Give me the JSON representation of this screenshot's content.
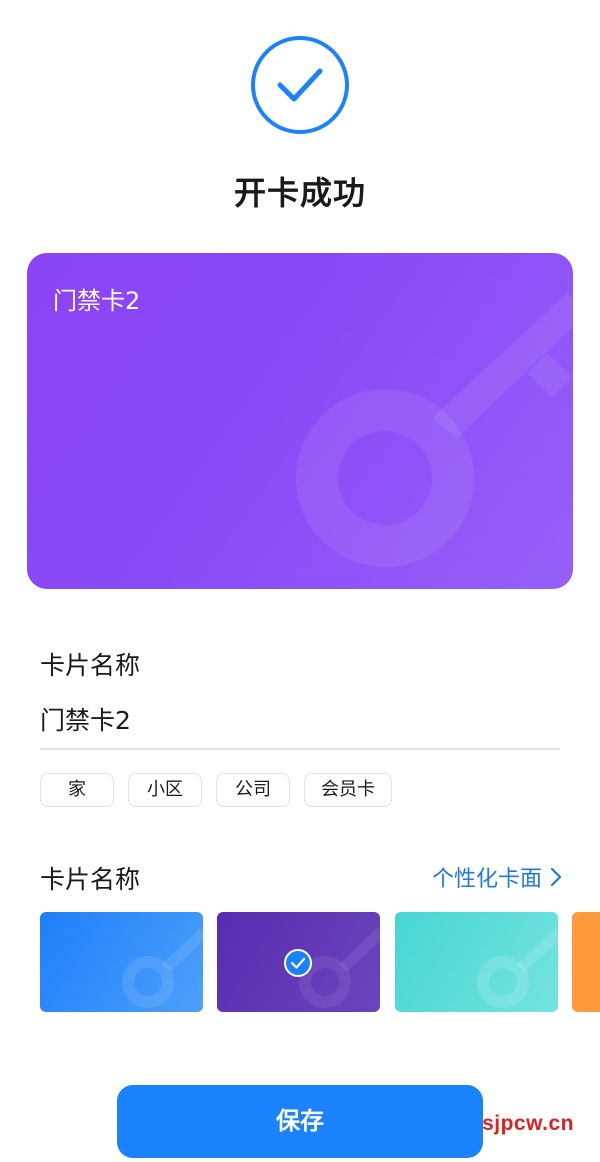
{
  "header": {
    "title": "开卡成功",
    "status_icon": "check-circle-icon",
    "accent_color": "#1a82fb"
  },
  "card": {
    "name": "门禁卡2",
    "color": "#8b45f6"
  },
  "name_section": {
    "label": "卡片名称",
    "value": "门禁卡2"
  },
  "tags": [
    {
      "label": "家"
    },
    {
      "label": "小区"
    },
    {
      "label": "公司"
    },
    {
      "label": "会员卡"
    }
  ],
  "skin_section": {
    "label": "卡片名称",
    "customize_label": "个性化卡面",
    "customize_icon": "chevron-right-icon",
    "link_color": "#1f7ae0",
    "skins": [
      {
        "name": "blue",
        "color": "#2a86fb",
        "selected": false
      },
      {
        "name": "purple",
        "color": "#5a2fb2",
        "selected": true
      },
      {
        "name": "cyan",
        "color": "#52d9d6",
        "selected": false
      },
      {
        "name": "orange",
        "color": "#ff9a3c",
        "selected": false
      }
    ]
  },
  "actions": {
    "save_label": "保存"
  },
  "watermark": {
    "text": "sjpcw.cn"
  }
}
